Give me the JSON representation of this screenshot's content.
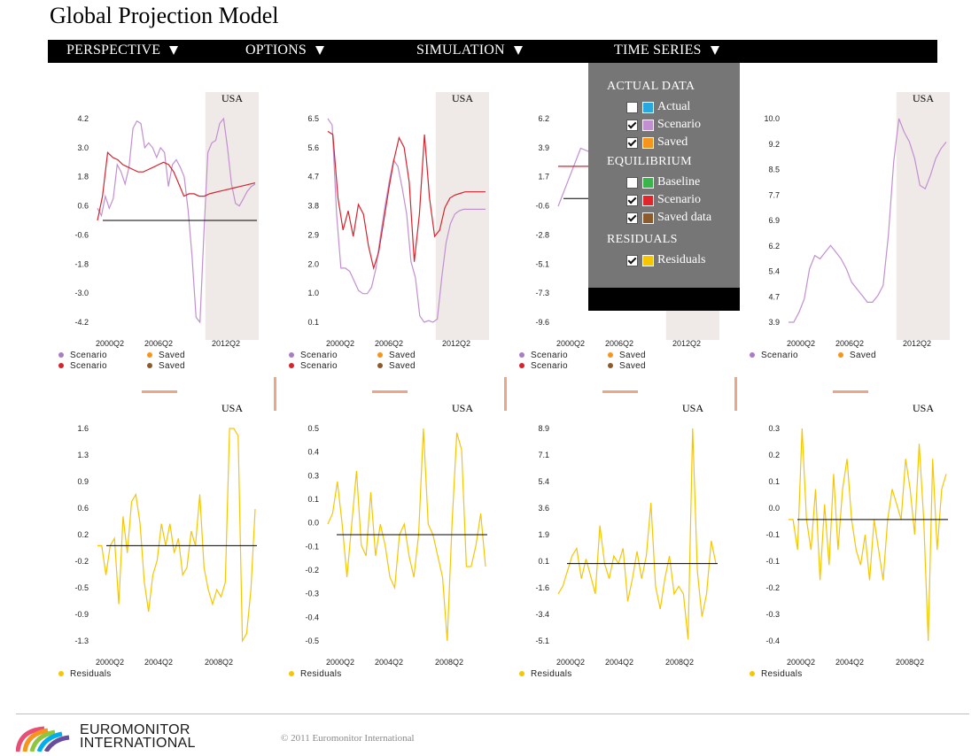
{
  "app": {
    "title": "Global Projection Model"
  },
  "menu": [
    {
      "label": "PERSPECTIVE"
    },
    {
      "label": "OPTIONS"
    },
    {
      "label": "SIMULATION"
    },
    {
      "label": "TIME SERIES"
    }
  ],
  "dropdown": {
    "sections": [
      {
        "heading": "ACTUAL DATA",
        "items": [
          {
            "label": "Actual",
            "checked": false,
            "color": "#29a8e0"
          },
          {
            "label": "Scenario",
            "checked": true,
            "color": "#c28fd0"
          },
          {
            "label": "Saved",
            "checked": true,
            "color": "#f7941d"
          }
        ]
      },
      {
        "heading": "EQUILIBRIUM",
        "items": [
          {
            "label": "Baseline",
            "checked": false,
            "color": "#39b54a"
          },
          {
            "label": "Scenario",
            "checked": true,
            "color": "#e0262b"
          },
          {
            "label": "Saved data",
            "checked": true,
            "color": "#8c5a2b"
          }
        ]
      },
      {
        "heading": "RESIDUALS",
        "items": [
          {
            "label": "Residuals",
            "checked": true,
            "color": "#f7c600"
          }
        ]
      }
    ]
  },
  "charts_top": [
    {
      "country": "USA",
      "yticks": [
        "4.2",
        "3.0",
        "1.8",
        "0.6",
        "-0.6",
        "-1.8",
        "-3.0",
        "-4.2"
      ],
      "xticks": [
        "2000Q2",
        "2006Q2",
        "2012Q2"
      ],
      "legend": [
        {
          "label": "Scenario",
          "color": "#a97cc4"
        },
        {
          "label": "Saved",
          "color": "#f7941d"
        },
        {
          "label": "Scenario",
          "color": "#d6232e"
        },
        {
          "label": "Saved",
          "color": "#8c5a2b"
        }
      ]
    },
    {
      "country": "USA",
      "yticks": [
        "6.5",
        "5.6",
        "4.7",
        "3.8",
        "2.9",
        "2.0",
        "1.0",
        "0.1"
      ],
      "xticks": [
        "2000Q2",
        "2006Q2",
        "2012Q2"
      ],
      "legend": [
        {
          "label": "Scenario",
          "color": "#a97cc4"
        },
        {
          "label": "Saved",
          "color": "#f7941d"
        },
        {
          "label": "Scenario",
          "color": "#d6232e"
        },
        {
          "label": "Saved",
          "color": "#8c5a2b"
        }
      ]
    },
    {
      "country": "USA",
      "yticks": [
        "6.2",
        "3.9",
        "1.7",
        "-0.6",
        "-2.8",
        "-5.1",
        "-7.3",
        "-9.6"
      ],
      "xticks": [
        "2000Q2",
        "2006Q2",
        "2012Q2"
      ],
      "legend": [
        {
          "label": "Scenario",
          "color": "#a97cc4"
        },
        {
          "label": "Saved",
          "color": "#f7941d"
        },
        {
          "label": "Scenario",
          "color": "#d6232e"
        },
        {
          "label": "Saved",
          "color": "#8c5a2b"
        }
      ]
    },
    {
      "country": "USA",
      "yticks": [
        "10.0",
        "9.2",
        "8.5",
        "7.7",
        "6.9",
        "6.2",
        "5.4",
        "4.7",
        "3.9"
      ],
      "xticks": [
        "2000Q2",
        "2006Q2",
        "2012Q2"
      ],
      "legend": [
        {
          "label": "Scenario",
          "color": "#a97cc4"
        },
        {
          "label": "Saved",
          "color": "#f7941d"
        }
      ]
    }
  ],
  "charts_bottom": [
    {
      "country": "USA",
      "yticks": [
        "1.6",
        "1.3",
        "0.9",
        "0.6",
        "0.2",
        "-0.2",
        "-0.5",
        "-0.9",
        "-1.3"
      ],
      "xticks": [
        "2000Q2",
        "2004Q2",
        "2008Q2"
      ],
      "legend": [
        {
          "label": "Residuals",
          "color": "#f7c600"
        }
      ]
    },
    {
      "country": "USA",
      "yticks": [
        "0.5",
        "0.4",
        "0.3",
        "0.1",
        "0.0",
        "-0.1",
        "-0.2",
        "-0.3",
        "-0.4",
        "-0.5"
      ],
      "xticks": [
        "2000Q2",
        "2004Q2",
        "2008Q2"
      ],
      "legend": [
        {
          "label": "Residuals",
          "color": "#f7c600"
        }
      ]
    },
    {
      "country": "USA",
      "yticks": [
        "8.9",
        "7.1",
        "5.4",
        "3.6",
        "1.9",
        "0.1",
        "-1.6",
        "-3.4",
        "-5.1"
      ],
      "xticks": [
        "2000Q2",
        "2004Q2",
        "2008Q2"
      ],
      "legend": [
        {
          "label": "Residuals",
          "color": "#f7c600"
        }
      ]
    },
    {
      "country": "USA",
      "yticks": [
        "0.3",
        "0.2",
        "0.1",
        "0.0",
        "-0.1",
        "-0.1",
        "-0.2",
        "-0.3",
        "-0.4"
      ],
      "xticks": [
        "2000Q2",
        "2004Q2",
        "2008Q2"
      ],
      "legend": [
        {
          "label": "Residuals",
          "color": "#f7c600"
        }
      ]
    }
  ],
  "chart_data": [
    {
      "type": "line",
      "x_range": [
        "1998Q1",
        "2016Q4"
      ],
      "ylim": [
        -4.2,
        4.2
      ],
      "projection_from": "2010Q4",
      "series": [
        {
          "name": "Scenario",
          "color": "#c28fd0",
          "values": [
            0.5,
            0.2,
            1.0,
            0.5,
            0.9,
            2.3,
            2.0,
            1.5,
            2.2,
            3.8,
            4.1,
            4.0,
            3.0,
            3.2,
            3.0,
            2.6,
            3.0,
            2.8,
            1.4,
            2.3,
            2.5,
            2.2,
            1.8,
            0.4,
            -1.5,
            -4.0,
            -4.2,
            -0.5,
            2.8,
            3.2,
            3.3,
            4.0,
            4.2,
            3.0,
            1.5,
            0.7,
            0.6,
            0.9,
            1.2,
            1.4,
            1.5
          ]
        },
        {
          "name": "Scenario",
          "color": "#d6232e",
          "values": [
            0.0,
            1.0,
            2.8,
            2.6,
            2.5,
            2.3,
            2.2,
            2.1,
            2.0,
            2.0,
            2.1,
            2.2,
            2.3,
            2.4,
            2.3,
            2.0,
            1.5,
            1.0,
            1.1,
            1.1,
            1.0,
            1.0,
            1.1,
            1.15,
            1.2,
            1.25,
            1.3,
            1.35,
            1.4,
            1.45,
            1.5,
            1.55
          ]
        }
      ]
    },
    {
      "type": "line",
      "x_range": [
        "1998Q1",
        "2016Q4"
      ],
      "ylim": [
        0.1,
        6.5
      ],
      "projection_from": "2010Q4",
      "series": [
        {
          "name": "Scenario",
          "color": "#c28fd0",
          "values": [
            6.5,
            6.3,
            3.5,
            1.8,
            1.8,
            1.7,
            1.4,
            1.1,
            1.0,
            1.0,
            1.2,
            1.8,
            2.8,
            3.7,
            4.5,
            5.2,
            5.0,
            4.3,
            3.5,
            2.0,
            1.5,
            0.3,
            0.1,
            0.15,
            0.1,
            0.2,
            1.5,
            2.6,
            3.2,
            3.5,
            3.6,
            3.65,
            3.65,
            3.65,
            3.65,
            3.65,
            3.65
          ]
        },
        {
          "name": "Scenario",
          "color": "#d6232e",
          "values": [
            6.1,
            6.0,
            4.0,
            3.0,
            3.6,
            2.8,
            3.8,
            3.5,
            2.5,
            1.8,
            2.3,
            3.3,
            4.3,
            5.2,
            5.9,
            5.6,
            4.5,
            2.0,
            3.5,
            6.0,
            4.0,
            2.8,
            3.0,
            3.7,
            4.0,
            4.1,
            4.15,
            4.2,
            4.2,
            4.2,
            4.2,
            4.2
          ]
        }
      ]
    },
    {
      "type": "line",
      "x_range": [
        "1998Q1",
        "2016Q4"
      ],
      "ylim": [
        -9.6,
        6.2
      ],
      "projection_from": "2010Q4",
      "series": [
        {
          "name": "Scenario",
          "color": "#c28fd0",
          "values": [
            -0.6,
            3.9,
            3.2,
            1.7,
            -0.6,
            2.5,
            3.0,
            1.7
          ]
        },
        {
          "name": "Scenario",
          "color": "#d6232e",
          "values": [
            2.5,
            2.5,
            2.5,
            2.5,
            2.5,
            2.5,
            2.5,
            2.5,
            2.5,
            2.5
          ]
        }
      ]
    },
    {
      "type": "line",
      "x_range": [
        "1998Q1",
        "2016Q4"
      ],
      "ylim": [
        3.9,
        10.0
      ],
      "projection_from": "2010Q4",
      "series": [
        {
          "name": "Scenario",
          "color": "#c28fd0",
          "values": [
            3.9,
            3.85,
            4.2,
            4.6,
            5.5,
            5.9,
            5.8,
            6.0,
            6.2,
            6.0,
            5.8,
            5.5,
            5.1,
            4.9,
            4.7,
            4.5,
            4.5,
            4.7,
            5.0,
            6.5,
            8.7,
            10.0,
            9.6,
            9.3,
            8.8,
            8.0,
            7.9,
            8.3,
            8.8,
            9.1,
            9.3
          ]
        }
      ]
    },
    {
      "type": "line",
      "x_range": [
        "1998Q1",
        "2010Q4"
      ],
      "ylim": [
        -1.3,
        1.6
      ],
      "series": [
        {
          "name": "Residuals",
          "color": "#f7c600",
          "values": [
            0.0,
            0.0,
            -0.4,
            0.0,
            0.1,
            -0.8,
            0.4,
            -0.1,
            0.6,
            0.7,
            0.3,
            -0.5,
            -0.9,
            -0.4,
            -0.2,
            0.3,
            0.0,
            0.3,
            -0.1,
            0.1,
            -0.4,
            -0.3,
            0.2,
            0.0,
            0.7,
            -0.3,
            -0.6,
            -0.8,
            -0.6,
            -0.7,
            -0.5,
            1.6,
            1.6,
            1.5,
            -1.3,
            -1.2,
            -0.6,
            0.5
          ]
        },
        {
          "name": "Zero",
          "color": "#000000",
          "values": [
            0.0,
            0.0
          ]
        }
      ]
    },
    {
      "type": "line",
      "x_range": [
        "1998Q1",
        "2010Q4"
      ],
      "ylim": [
        -0.5,
        0.5
      ],
      "series": [
        {
          "name": "Residuals",
          "color": "#f7c600",
          "values": [
            0.05,
            0.1,
            0.25,
            0.05,
            -0.2,
            0.05,
            0.3,
            -0.05,
            -0.1,
            0.2,
            -0.1,
            0.05,
            -0.05,
            -0.2,
            -0.25,
            0.0,
            0.05,
            -0.1,
            -0.2,
            0.0,
            0.5,
            0.05,
            0.0,
            -0.1,
            -0.2,
            -0.5,
            0.05,
            0.48,
            0.4,
            -0.15,
            -0.15,
            -0.05,
            0.1,
            -0.15
          ]
        },
        {
          "name": "Zero",
          "color": "#000000",
          "values": [
            0.0,
            0.0
          ]
        }
      ]
    },
    {
      "type": "line",
      "x_range": [
        "1998Q1",
        "2010Q4"
      ],
      "ylim": [
        -5.1,
        8.9
      ],
      "series": [
        {
          "name": "Residuals",
          "color": "#f7c600",
          "values": [
            -2.0,
            -1.5,
            -0.5,
            0.5,
            1.0,
            -1.0,
            0.3,
            -0.8,
            -2.0,
            2.5,
            0.0,
            -1.0,
            0.5,
            0.0,
            1.0,
            -2.5,
            -1.0,
            0.8,
            -1.0,
            0.5,
            4.0,
            -1.5,
            -3.0,
            -1.0,
            0.5,
            -2.0,
            -1.5,
            -2.0,
            -5.0,
            9.0,
            -0.5,
            -3.5,
            -2.0,
            1.5,
            0.0
          ]
        },
        {
          "name": "Zero",
          "color": "#000000",
          "values": [
            0.0,
            0.0
          ]
        }
      ]
    },
    {
      "type": "line",
      "x_range": [
        "1998Q1",
        "2010Q4"
      ],
      "ylim": [
        -0.4,
        0.3
      ],
      "series": [
        {
          "name": "Residuals",
          "color": "#f7c600",
          "values": [
            0.0,
            0.0,
            -0.1,
            0.3,
            0.0,
            -0.1,
            0.1,
            -0.2,
            0.05,
            -0.15,
            0.15,
            -0.1,
            0.1,
            0.2,
            0.0,
            -0.1,
            -0.15,
            -0.05,
            -0.2,
            0.0,
            -0.1,
            -0.2,
            0.0,
            0.1,
            0.05,
            0.0,
            0.2,
            0.1,
            -0.05,
            0.25,
            0.0,
            -0.4,
            0.2,
            -0.1,
            0.1,
            0.15
          ]
        },
        {
          "name": "Zero",
          "color": "#000000",
          "values": [
            0.0,
            0.0
          ]
        }
      ]
    }
  ],
  "footer": {
    "copyright": "© 2011 Euromonitor International",
    "logo_line1": "EUROMONITOR",
    "logo_line2": "INTERNATIONAL"
  }
}
